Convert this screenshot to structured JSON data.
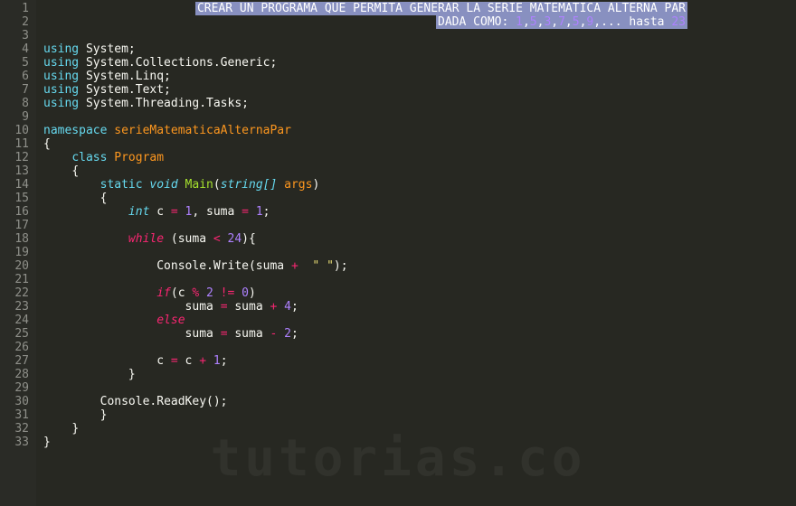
{
  "gutter": {
    "start": 1,
    "end": 33
  },
  "highlight": {
    "line1_text": "CREAR UN PROGRAMA QUE PERMITA GENERAR LA SERIE MATEMATICA ALTERNA PAR",
    "line2_prefix": "DADA COMO: ",
    "line2_series": [
      "1",
      ",",
      "5",
      ",",
      "3",
      ",",
      "7",
      ",",
      "5",
      ",",
      "9",
      ",",
      "... hasta ",
      "23"
    ]
  },
  "code": {
    "using1_kw": "using",
    "using1_ns": " System;",
    "using2_kw": "using",
    "using2_ns": " System.Collections.Generic;",
    "using3_kw": "using",
    "using3_ns": " System.Linq;",
    "using4_kw": "using",
    "using4_ns": " System.Text;",
    "using5_kw": "using",
    "using5_ns": " System.Threading.Tasks;",
    "ns_kw": "namespace",
    "ns_name": " serieMatematicaAlternaPar",
    "brace_open": "{",
    "brace_close": "}",
    "class_kw": "class",
    "class_name": " Program",
    "static_kw": "static",
    "void_kw": " void",
    "main_name": " Main",
    "paren_open": "(",
    "paren_close": ")",
    "stringarr": "string[]",
    "args": " args",
    "int_t": "int",
    "c_decl": " c ",
    "eq": "= ",
    "one": "1",
    "comma_suma": ", suma ",
    "eq2": "= ",
    "one2": "1",
    "semi": ";",
    "while_kw": "while",
    "while_sp": " (suma ",
    "lt": "< ",
    "n24": "24",
    "while_close": "){",
    "console_write": "Console.Write(suma ",
    "plus": "+ ",
    "strlit": " \" \"",
    "write_end": ");",
    "if_kw": "if",
    "if_open": "(c ",
    "mod": "% ",
    "n2": "2",
    "neq": " != ",
    "n0": "0",
    "if_close": ")",
    "suma_assign": "suma ",
    "eq3": "= ",
    "suma_plus": "suma ",
    "plus2": "+ ",
    "n4": "4",
    "semi2": ";",
    "else_kw": "else",
    "suma_assign2": "suma ",
    "eq4": "= ",
    "suma_minus": "suma ",
    "minus": "- ",
    "n2b": "2",
    "semi3": ";",
    "c_inc": "c ",
    "eq5": "= ",
    "c_plus": "c ",
    "plus3": "+ ",
    "n1": "1",
    "semi4": ";",
    "readkey": "Console.ReadKey();"
  },
  "watermark": "tutorias.co"
}
